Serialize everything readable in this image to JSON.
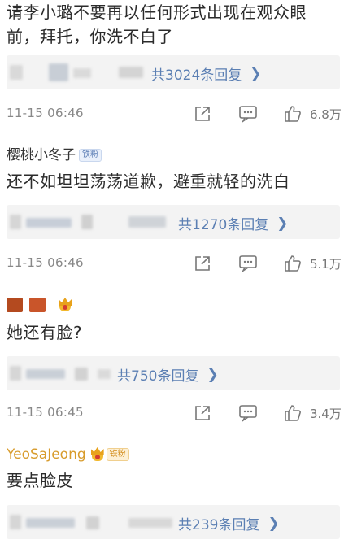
{
  "comments": [
    {
      "text_line1": "请李小璐不要再以任何形式出现在观众眼",
      "text_line2": "前，拜托，你洗不白了",
      "reply_link": "共3024条回复",
      "timestamp": "11-15 06:46",
      "like_count": "6.8万"
    },
    {
      "username": "樱桃小冬子",
      "badge": "铁粉",
      "text": "还不如坦坦荡荡道歉，避重就轻的洗白",
      "reply_link": "共1270条回复",
      "timestamp": "11-15 06:46",
      "like_count": "5.1万"
    },
    {
      "text": "她还有脸?",
      "reply_link": "共750条回复",
      "timestamp": "11-15 06:45",
      "like_count": "3.4万"
    },
    {
      "username": "YeoSaJeong",
      "badge": "铁粉",
      "text": "要点脸皮",
      "reply_link": "共239条回复"
    }
  ],
  "icons": {
    "share": "share-icon",
    "comment": "comment-icon",
    "like": "thumbs-up-icon",
    "chevron": "chevron-right-icon"
  },
  "colors": {
    "link": "#5b7fb3",
    "username_gold": "#d89b2b",
    "meta_gray": "#888888",
    "reply_bg": "#f3f3f3"
  }
}
